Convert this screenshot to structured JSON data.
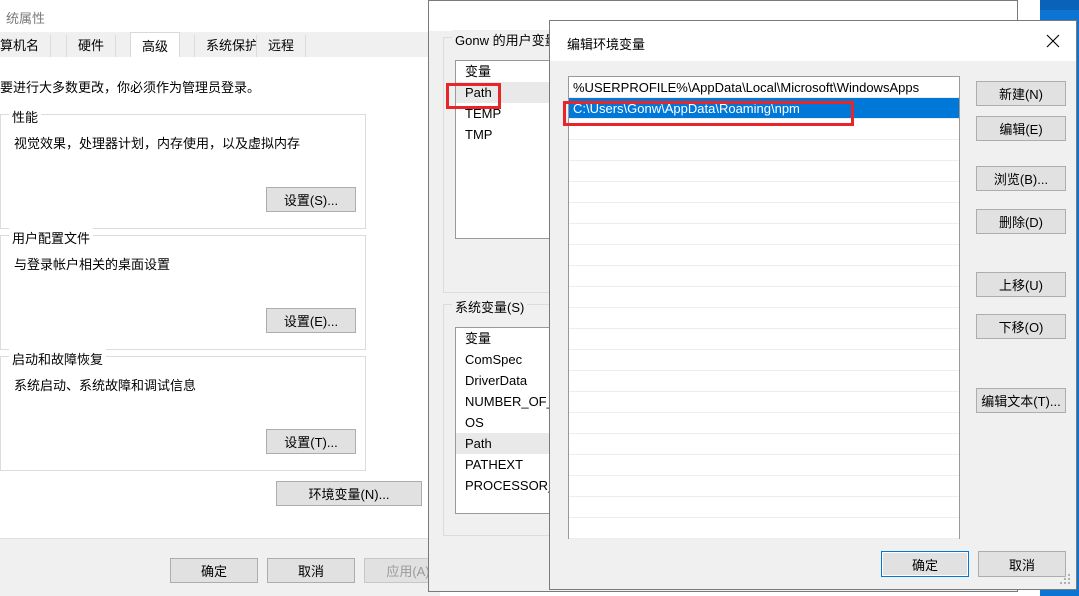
{
  "system_properties": {
    "title": "统属性",
    "tabs": [
      {
        "label": "算机名",
        "active": false
      },
      {
        "label": "硬件",
        "active": false
      },
      {
        "label": "高级",
        "active": true
      },
      {
        "label": "系统保护",
        "active": false
      },
      {
        "label": "远程",
        "active": false
      }
    ],
    "intro": "要进行大多数更改，你必须作为管理员登录。",
    "groups": [
      {
        "label": "性能",
        "desc": "视觉效果，处理器计划，内存使用，以及虚拟内存",
        "button": "设置(S)..."
      },
      {
        "label": "用户配置文件",
        "desc": "与登录帐户相关的桌面设置",
        "button": "设置(E)..."
      },
      {
        "label": "启动和故障恢复",
        "desc": "系统启动、系统故障和调试信息",
        "button": "设置(T)..."
      }
    ],
    "env_button": "环境变量(N)...",
    "footer": {
      "ok": "确定",
      "cancel": "取消",
      "apply": "应用(A)"
    }
  },
  "env_variables": {
    "user_group_label": "Gonw 的用户变量(U)",
    "user_column_header": "变量",
    "user_vars": [
      "Path",
      "TEMP",
      "TMP"
    ],
    "user_selected": "Path",
    "system_group_label": "系统变量(S)",
    "system_column_header": "变量",
    "system_vars": [
      "ComSpec",
      "DriverData",
      "NUMBER_OF_PR",
      "OS",
      "Path",
      "PATHEXT",
      "PROCESSOR_AR"
    ],
    "system_selected": "Path"
  },
  "edit_dialog": {
    "title": "编辑环境变量",
    "close_icon": "close-icon",
    "entries": [
      "%USERPROFILE%\\AppData\\Local\\Microsoft\\WindowsApps",
      "C:\\Users\\Gonw\\AppData\\Roaming\\npm"
    ],
    "selected_index": 1,
    "empty_row_count": 19,
    "side_buttons": [
      {
        "label": "新建(N)",
        "name": "new-button"
      },
      {
        "label": "编辑(E)",
        "name": "edit-button"
      },
      {
        "label": "浏览(B)...",
        "name": "browse-button"
      },
      {
        "label": "删除(D)",
        "name": "delete-button"
      },
      {
        "label": "上移(U)",
        "name": "move-up-button"
      },
      {
        "label": "下移(O)",
        "name": "move-down-button"
      },
      {
        "label": "编辑文本(T)...",
        "name": "edit-text-button"
      }
    ],
    "ok": "确定",
    "cancel": "取消"
  },
  "annotations": {
    "highlight_color": "#e8262a",
    "boxes": [
      "user-path-variable",
      "npm-path-entry"
    ]
  },
  "colors": {
    "accent_blue": "#0078d7",
    "desktop_blue": "#0c75d4",
    "selection_blue": "#0078d7",
    "annotation_red": "#e8262a"
  }
}
